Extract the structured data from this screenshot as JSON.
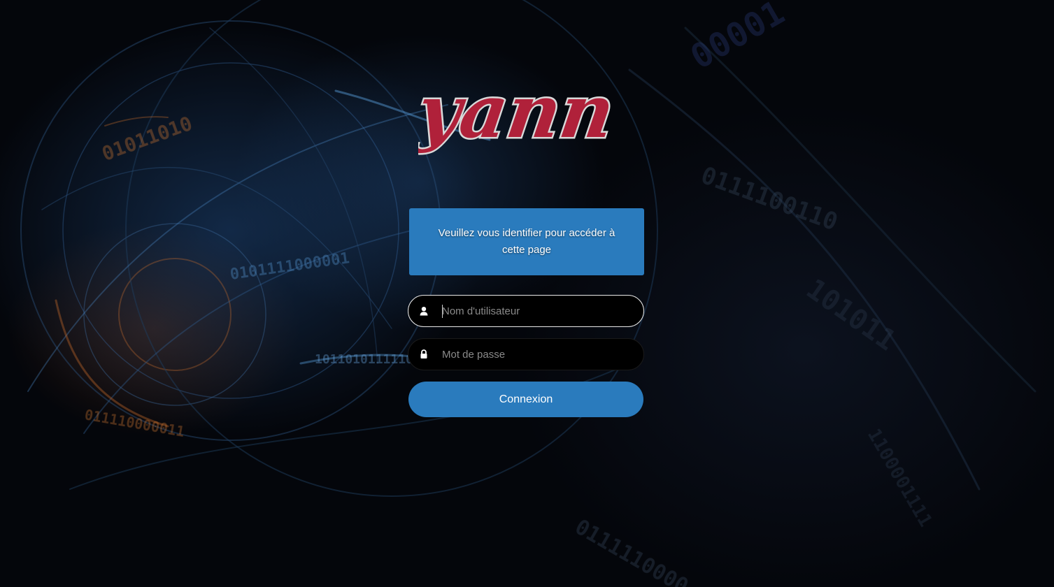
{
  "logo": {
    "text": "yann"
  },
  "login": {
    "message": "Veuillez vous identifier pour accéder à cette page",
    "username": {
      "placeholder": "Nom d'utilisateur",
      "value": "",
      "icon": "user-icon"
    },
    "password": {
      "placeholder": "Mot de passe",
      "value": "",
      "icon": "lock-icon"
    },
    "submit_label": "Connexion"
  },
  "colors": {
    "accent": "#2a7bbd",
    "field_bg": "#000000",
    "logo_red": "#b0213a"
  }
}
